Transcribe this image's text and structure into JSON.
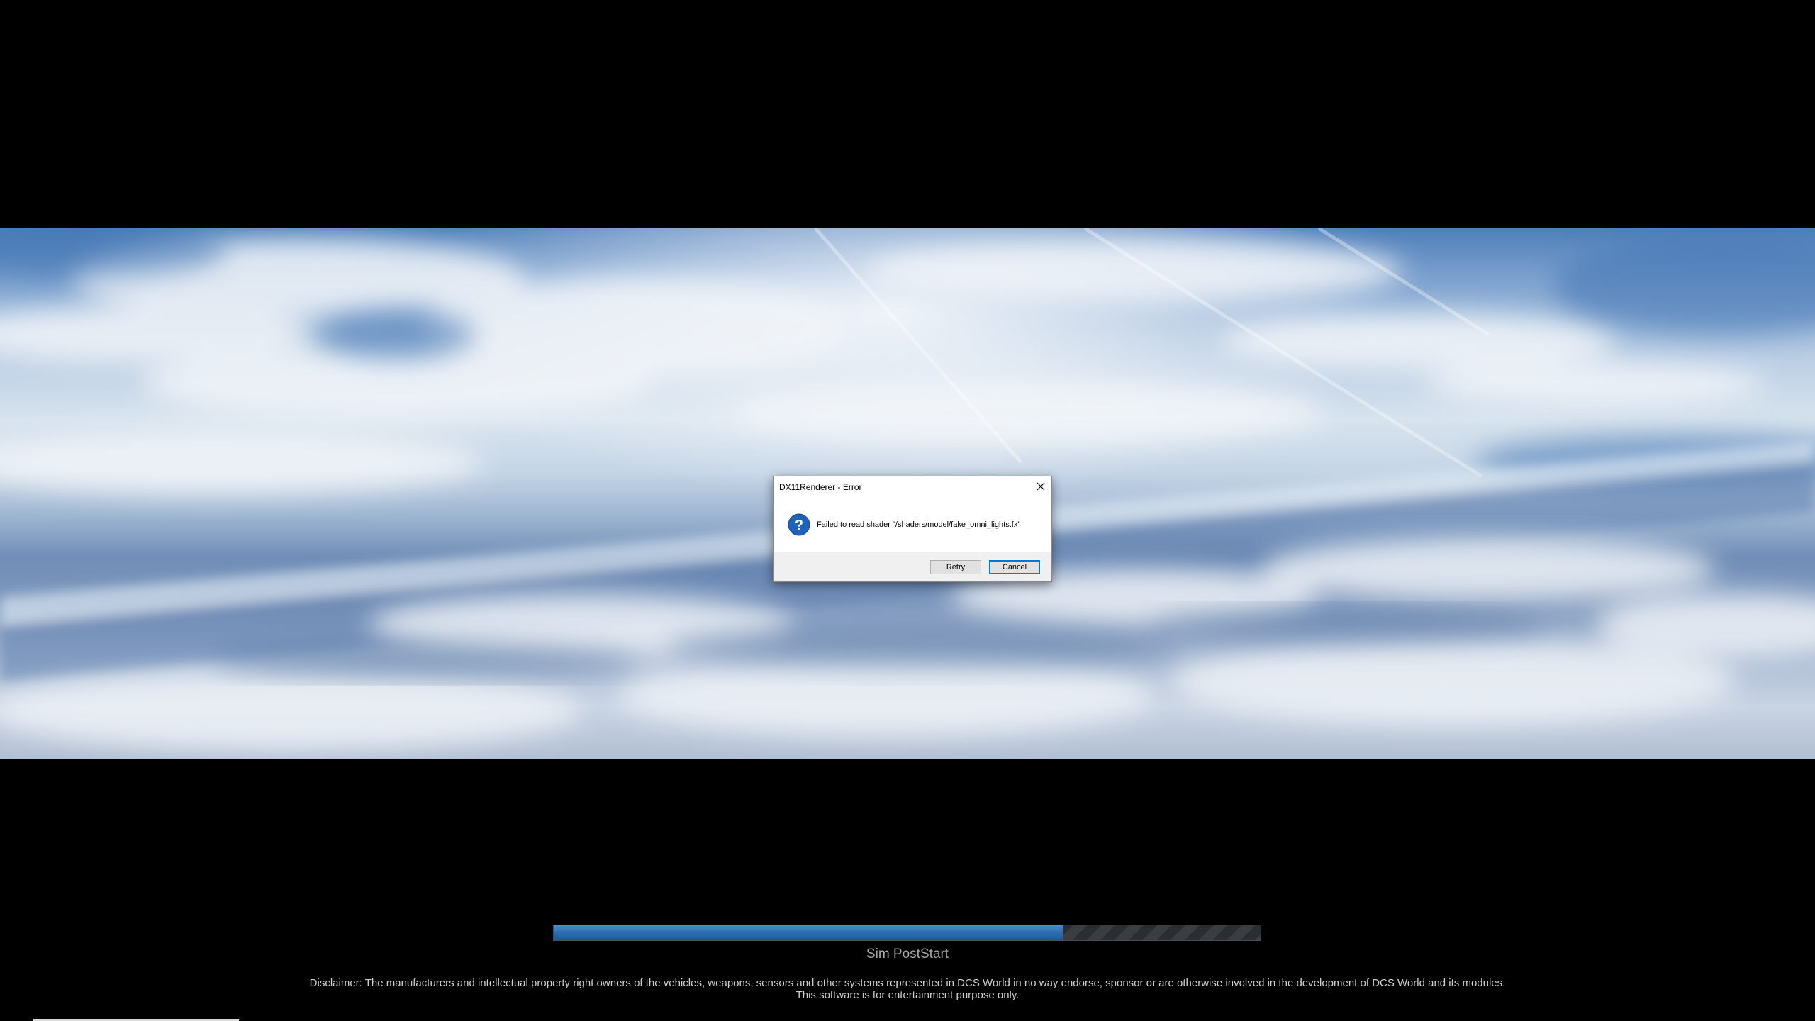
{
  "dialog": {
    "title": "DX11Renderer - Error",
    "icon": "question-icon",
    "message": "Failed to read shader \"/shaders/model/fake_omni_lights.fx\"",
    "retry_label": "Retry",
    "cancel_label": "Cancel"
  },
  "loading": {
    "status": "Sim PostStart",
    "progress_percent": 72
  },
  "disclaimer": {
    "line1": "Disclaimer: The manufacturers and intellectual property right owners of the vehicles, weapons, sensors and other systems represented in DCS World in no way endorse, sponsor or are otherwise involved in the development of DCS World and its modules.",
    "line2": "This software is for entertainment purpose only."
  },
  "colors": {
    "background": "#000000",
    "progress_fill": "#2e6fb4",
    "focus_border": "#0078d7",
    "status_text": "#a6a6a6"
  }
}
